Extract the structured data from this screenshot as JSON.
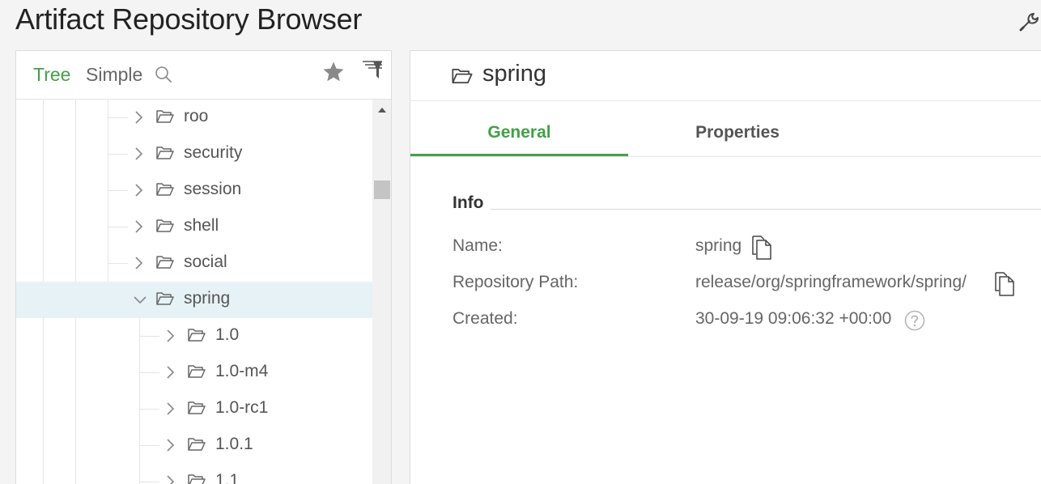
{
  "page_title": "Artifact Repository Browser",
  "left_panel": {
    "modes": {
      "tree": "Tree",
      "simple": "Simple"
    },
    "tree_items": [
      {
        "label": "roo"
      },
      {
        "label": "security"
      },
      {
        "label": "session"
      },
      {
        "label": "shell"
      },
      {
        "label": "social"
      },
      {
        "label": "spring"
      },
      {
        "label": "1.0"
      },
      {
        "label": "1.0-m4"
      },
      {
        "label": "1.0-rc1"
      },
      {
        "label": "1.0.1"
      },
      {
        "label": "1.1"
      }
    ]
  },
  "detail": {
    "title": "spring",
    "tabs": {
      "general": "General",
      "properties": "Properties"
    },
    "info": {
      "heading": "Info",
      "name_label": "Name:",
      "name_value": "spring",
      "path_label": "Repository Path:",
      "path_value": "release/org/springframework/spring/",
      "created_label": "Created:",
      "created_value": "30-09-19 09:06:32 +00:00"
    }
  },
  "colors": {
    "accent": "#43a047",
    "selected_row": "#e6f2f5"
  },
  "icons": [
    "wrench-icon",
    "search-icon",
    "star-icon",
    "filter-icon",
    "folder-icon",
    "chevron-right-icon",
    "chevron-down-icon",
    "copy-icon",
    "help-icon"
  ]
}
